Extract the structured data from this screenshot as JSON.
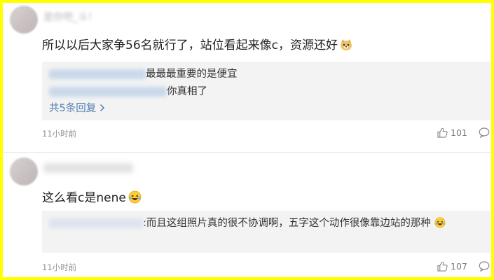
{
  "comments": [
    {
      "username": "是你吧_斗！",
      "text": "所以以后大家争56名就行了，站位看起来像c，资源还好",
      "emoji": "doge-emoji",
      "replies": [
        {
          "text": "最最最重要的是便宜"
        },
        {
          "text": "你真相了"
        }
      ],
      "more_replies": "共5条回复",
      "time": "11小时前",
      "likes": "101"
    },
    {
      "username": "",
      "text": "这么看c是nene",
      "emoji": "laughing-emoji",
      "replies": [
        {
          "text": ":而且这组照片真的很不协调啊，五字这个动作很像靠边站的那种"
        }
      ],
      "time": "11小时前",
      "likes": "107"
    }
  ],
  "colors": {
    "frame": "#ffff00",
    "link": "#507daf",
    "reply_bg": "#f3f3f3",
    "time": "#909090"
  }
}
